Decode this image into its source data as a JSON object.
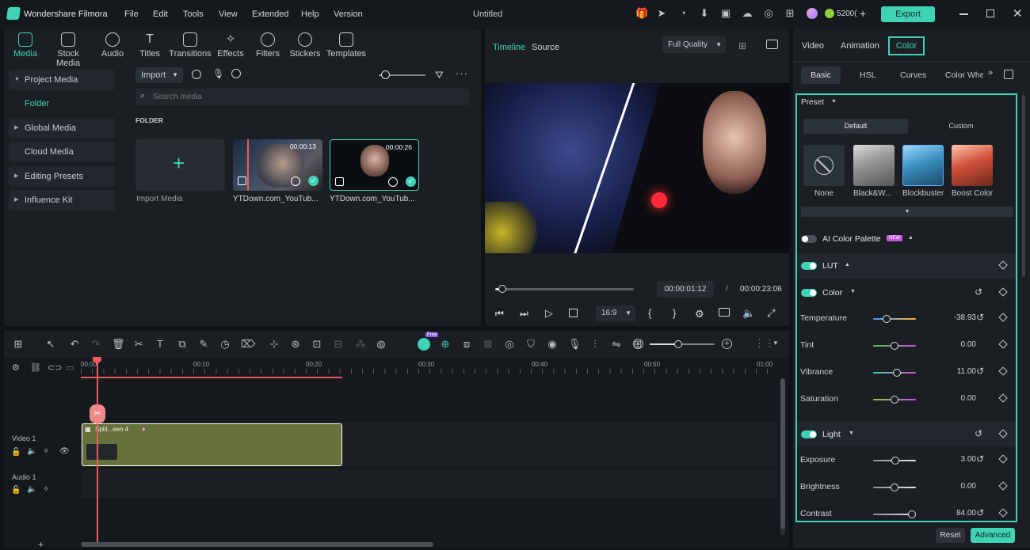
{
  "app": {
    "name": "Wondershare Filmora",
    "document_title": "Untitled",
    "credits": "5200(",
    "export_label": "Export"
  },
  "menu": [
    "File",
    "Edit",
    "Tools",
    "View",
    "Extended",
    "Help",
    "Version"
  ],
  "media_tabs": [
    {
      "label": "Media",
      "icon": "media-icon"
    },
    {
      "label": "Stock Media",
      "icon": "stock-media-icon"
    },
    {
      "label": "Audio",
      "icon": "audio-icon"
    },
    {
      "label": "Titles",
      "icon": "titles-icon"
    },
    {
      "label": "Transitions",
      "icon": "transitions-icon"
    },
    {
      "label": "Effects",
      "icon": "effects-icon"
    },
    {
      "label": "Filters",
      "icon": "filters-icon"
    },
    {
      "label": "Stickers",
      "icon": "stickers-icon"
    },
    {
      "label": "Templates",
      "icon": "templates-icon"
    }
  ],
  "sidebar": {
    "items": [
      {
        "label": "Project Media"
      },
      {
        "label": "Folder"
      },
      {
        "label": "Global Media"
      },
      {
        "label": "Cloud Media"
      },
      {
        "label": "Editing Presets"
      },
      {
        "label": "Influence Kit"
      }
    ]
  },
  "media_toolbar": {
    "import_label": "Import",
    "search_placeholder": "Search media",
    "folder_heading": "FOLDER"
  },
  "media_items": [
    {
      "label": "Import Media"
    },
    {
      "label": "YTDown.com_YouTub...",
      "duration": "00:00:13"
    },
    {
      "label": "YTDown.com_YouTub...",
      "duration": "00:00:26"
    }
  ],
  "player": {
    "tab_timeline": "Timeline",
    "tab_source": "Source",
    "quality": "Full Quality",
    "current_time": "00:00:01:12",
    "separator": "/",
    "total_time": "00:00:23:06",
    "aspect": "16:9",
    "progress": 0.05
  },
  "timeline": {
    "ruler": [
      "00:00",
      "00:10",
      "00:20",
      "00:30",
      "00:40",
      "00:50",
      "01:00"
    ],
    "video_track": "Video 1",
    "audio_track": "Audio 1",
    "clip_label": "Split...een 4",
    "new_badge": "Free"
  },
  "properties": {
    "tabs": [
      "Video",
      "Animation",
      "Color"
    ],
    "subtabs": [
      "Basic",
      "HSL",
      "Curves",
      "Color Whe"
    ],
    "preset_label": "Preset",
    "preset_tabs": [
      "Default",
      "Custom"
    ],
    "presets": [
      "None",
      "Black&W...",
      "Blockbuster",
      "Boost Color"
    ],
    "ai_palette": "AI Color Palette",
    "new_badge": "NEW",
    "lut": "LUT",
    "color": "Color",
    "light": "Light",
    "color_rows": [
      {
        "label": "Temperature",
        "value": "-38.93",
        "level": 0.31
      },
      {
        "label": "Tint",
        "value": "0.00",
        "level": 0.5
      },
      {
        "label": "Vibrance",
        "value": "11.00",
        "level": 0.55
      },
      {
        "label": "Saturation",
        "value": "0.00",
        "level": 0.5
      }
    ],
    "light_rows": [
      {
        "label": "Exposure",
        "value": "3.00",
        "level": 0.51
      },
      {
        "label": "Brightness",
        "value": "0.00",
        "level": 0.5
      },
      {
        "label": "Contrast",
        "value": "84.00",
        "level": 0.9
      }
    ],
    "reset_label": "Reset",
    "advanced_label": "Advanced"
  },
  "colors": {
    "accent": "#3fd2b4",
    "bg": "#101316",
    "panel": "#1b1f24",
    "clip": "#65703a",
    "playhead": "#ef5b5b"
  }
}
